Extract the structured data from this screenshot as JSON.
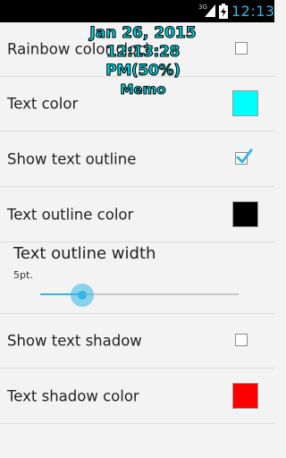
{
  "status_bar": {
    "network": "3G",
    "time": "12:13"
  },
  "clock_widget": {
    "date": "Jan 26, 2015",
    "time": "12:13:28 PM(50%)",
    "memo": "Memo",
    "text_color": "#00e6f0",
    "outline_color": "#000000"
  },
  "settings": {
    "rainbow_clock": {
      "label": "Rainbow color clock",
      "checked": false
    },
    "text_color": {
      "label": "Text color",
      "color": "#00ffff"
    },
    "show_outline": {
      "label": "Show text outline",
      "checked": true
    },
    "outline_color": {
      "label": "Text outline color",
      "color": "#000000"
    },
    "outline_width": {
      "label": "Text outline width",
      "value_text": "5pt.",
      "fraction": 0.21
    },
    "show_shadow": {
      "label": "Show text shadow",
      "checked": false
    },
    "shadow_color": {
      "label": "Text shadow color",
      "color": "#ff0000"
    }
  },
  "colors": {
    "accent": "#33b5e5",
    "status_bar_bg": "#000000",
    "background": "#f3f3f3"
  }
}
